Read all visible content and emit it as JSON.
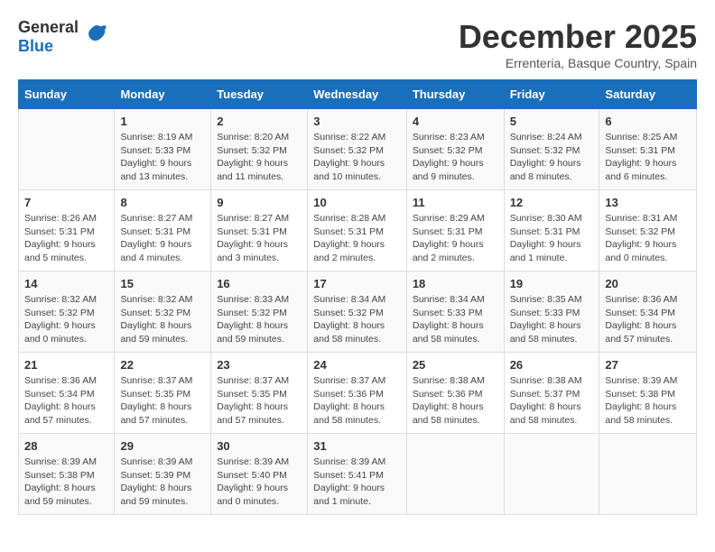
{
  "logo": {
    "general": "General",
    "blue": "Blue"
  },
  "title": {
    "month_year": "December 2025",
    "location": "Errenteria, Basque Country, Spain"
  },
  "calendar": {
    "headers": [
      "Sunday",
      "Monday",
      "Tuesday",
      "Wednesday",
      "Thursday",
      "Friday",
      "Saturday"
    ],
    "weeks": [
      [
        {
          "day": "",
          "sunrise": "",
          "sunset": "",
          "daylight": ""
        },
        {
          "day": "1",
          "sunrise": "Sunrise: 8:19 AM",
          "sunset": "Sunset: 5:33 PM",
          "daylight": "Daylight: 9 hours and 13 minutes."
        },
        {
          "day": "2",
          "sunrise": "Sunrise: 8:20 AM",
          "sunset": "Sunset: 5:32 PM",
          "daylight": "Daylight: 9 hours and 11 minutes."
        },
        {
          "day": "3",
          "sunrise": "Sunrise: 8:22 AM",
          "sunset": "Sunset: 5:32 PM",
          "daylight": "Daylight: 9 hours and 10 minutes."
        },
        {
          "day": "4",
          "sunrise": "Sunrise: 8:23 AM",
          "sunset": "Sunset: 5:32 PM",
          "daylight": "Daylight: 9 hours and 9 minutes."
        },
        {
          "day": "5",
          "sunrise": "Sunrise: 8:24 AM",
          "sunset": "Sunset: 5:32 PM",
          "daylight": "Daylight: 9 hours and 8 minutes."
        },
        {
          "day": "6",
          "sunrise": "Sunrise: 8:25 AM",
          "sunset": "Sunset: 5:31 PM",
          "daylight": "Daylight: 9 hours and 6 minutes."
        }
      ],
      [
        {
          "day": "7",
          "sunrise": "Sunrise: 8:26 AM",
          "sunset": "Sunset: 5:31 PM",
          "daylight": "Daylight: 9 hours and 5 minutes."
        },
        {
          "day": "8",
          "sunrise": "Sunrise: 8:27 AM",
          "sunset": "Sunset: 5:31 PM",
          "daylight": "Daylight: 9 hours and 4 minutes."
        },
        {
          "day": "9",
          "sunrise": "Sunrise: 8:27 AM",
          "sunset": "Sunset: 5:31 PM",
          "daylight": "Daylight: 9 hours and 3 minutes."
        },
        {
          "day": "10",
          "sunrise": "Sunrise: 8:28 AM",
          "sunset": "Sunset: 5:31 PM",
          "daylight": "Daylight: 9 hours and 2 minutes."
        },
        {
          "day": "11",
          "sunrise": "Sunrise: 8:29 AM",
          "sunset": "Sunset: 5:31 PM",
          "daylight": "Daylight: 9 hours and 2 minutes."
        },
        {
          "day": "12",
          "sunrise": "Sunrise: 8:30 AM",
          "sunset": "Sunset: 5:31 PM",
          "daylight": "Daylight: 9 hours and 1 minute."
        },
        {
          "day": "13",
          "sunrise": "Sunrise: 8:31 AM",
          "sunset": "Sunset: 5:32 PM",
          "daylight": "Daylight: 9 hours and 0 minutes."
        }
      ],
      [
        {
          "day": "14",
          "sunrise": "Sunrise: 8:32 AM",
          "sunset": "Sunset: 5:32 PM",
          "daylight": "Daylight: 9 hours and 0 minutes."
        },
        {
          "day": "15",
          "sunrise": "Sunrise: 8:32 AM",
          "sunset": "Sunset: 5:32 PM",
          "daylight": "Daylight: 8 hours and 59 minutes."
        },
        {
          "day": "16",
          "sunrise": "Sunrise: 8:33 AM",
          "sunset": "Sunset: 5:32 PM",
          "daylight": "Daylight: 8 hours and 59 minutes."
        },
        {
          "day": "17",
          "sunrise": "Sunrise: 8:34 AM",
          "sunset": "Sunset: 5:32 PM",
          "daylight": "Daylight: 8 hours and 58 minutes."
        },
        {
          "day": "18",
          "sunrise": "Sunrise: 8:34 AM",
          "sunset": "Sunset: 5:33 PM",
          "daylight": "Daylight: 8 hours and 58 minutes."
        },
        {
          "day": "19",
          "sunrise": "Sunrise: 8:35 AM",
          "sunset": "Sunset: 5:33 PM",
          "daylight": "Daylight: 8 hours and 58 minutes."
        },
        {
          "day": "20",
          "sunrise": "Sunrise: 8:36 AM",
          "sunset": "Sunset: 5:34 PM",
          "daylight": "Daylight: 8 hours and 57 minutes."
        }
      ],
      [
        {
          "day": "21",
          "sunrise": "Sunrise: 8:36 AM",
          "sunset": "Sunset: 5:34 PM",
          "daylight": "Daylight: 8 hours and 57 minutes."
        },
        {
          "day": "22",
          "sunrise": "Sunrise: 8:37 AM",
          "sunset": "Sunset: 5:35 PM",
          "daylight": "Daylight: 8 hours and 57 minutes."
        },
        {
          "day": "23",
          "sunrise": "Sunrise: 8:37 AM",
          "sunset": "Sunset: 5:35 PM",
          "daylight": "Daylight: 8 hours and 57 minutes."
        },
        {
          "day": "24",
          "sunrise": "Sunrise: 8:37 AM",
          "sunset": "Sunset: 5:36 PM",
          "daylight": "Daylight: 8 hours and 58 minutes."
        },
        {
          "day": "25",
          "sunrise": "Sunrise: 8:38 AM",
          "sunset": "Sunset: 5:36 PM",
          "daylight": "Daylight: 8 hours and 58 minutes."
        },
        {
          "day": "26",
          "sunrise": "Sunrise: 8:38 AM",
          "sunset": "Sunset: 5:37 PM",
          "daylight": "Daylight: 8 hours and 58 minutes."
        },
        {
          "day": "27",
          "sunrise": "Sunrise: 8:39 AM",
          "sunset": "Sunset: 5:38 PM",
          "daylight": "Daylight: 8 hours and 58 minutes."
        }
      ],
      [
        {
          "day": "28",
          "sunrise": "Sunrise: 8:39 AM",
          "sunset": "Sunset: 5:38 PM",
          "daylight": "Daylight: 8 hours and 59 minutes."
        },
        {
          "day": "29",
          "sunrise": "Sunrise: 8:39 AM",
          "sunset": "Sunset: 5:39 PM",
          "daylight": "Daylight: 8 hours and 59 minutes."
        },
        {
          "day": "30",
          "sunrise": "Sunrise: 8:39 AM",
          "sunset": "Sunset: 5:40 PM",
          "daylight": "Daylight: 9 hours and 0 minutes."
        },
        {
          "day": "31",
          "sunrise": "Sunrise: 8:39 AM",
          "sunset": "Sunset: 5:41 PM",
          "daylight": "Daylight: 9 hours and 1 minute."
        },
        {
          "day": "",
          "sunrise": "",
          "sunset": "",
          "daylight": ""
        },
        {
          "day": "",
          "sunrise": "",
          "sunset": "",
          "daylight": ""
        },
        {
          "day": "",
          "sunrise": "",
          "sunset": "",
          "daylight": ""
        }
      ]
    ]
  }
}
